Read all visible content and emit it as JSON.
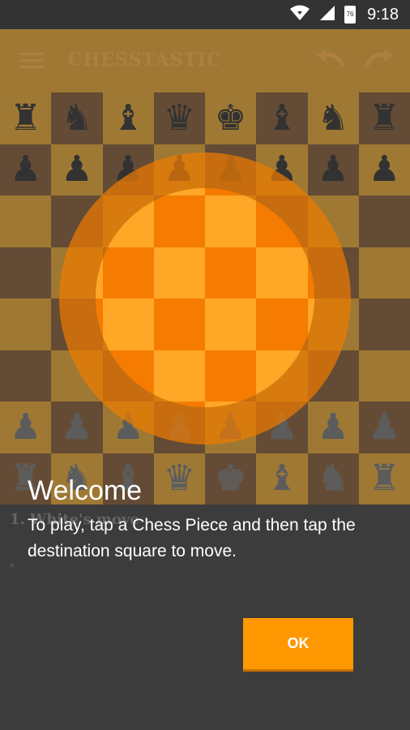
{
  "status_bar": {
    "time": "9:18",
    "battery_level": "76",
    "icons": [
      "wifi-icon",
      "cell-signal-icon",
      "battery-icon"
    ]
  },
  "app_bar": {
    "title": "CHESSTASTIC",
    "icons": [
      "hamburger-menu-icon",
      "undo-icon",
      "redo-icon"
    ]
  },
  "board": {
    "light_color": "#d59a2f",
    "dark_color": "#7a5432",
    "rank8": [
      "♜",
      "♞",
      "♝",
      "♛",
      "♚",
      "♝",
      "♞",
      "♜"
    ],
    "rank7": [
      "♟",
      "♟",
      "♟",
      "♟",
      "♟",
      "♟",
      "♟",
      "♟"
    ],
    "rank2": [
      "♟",
      "♟",
      "♟",
      "♟",
      "♟",
      "♟",
      "♟",
      "♟"
    ],
    "rank1": [
      "♜",
      "♞",
      "♝",
      "♛",
      "♚",
      "♝",
      "♞",
      "♜"
    ]
  },
  "below_board": {
    "move_label": "1. White's move",
    "marker": "*"
  },
  "tutorial": {
    "title": "Welcome",
    "body": "To play, tap a Chess Piece and then tap the destination square to move.",
    "ok_label": "OK",
    "spotlight_outer_color": "#f17c00",
    "spotlight_light_color": "#ffa726",
    "spotlight_dark_color": "#f57c00"
  }
}
